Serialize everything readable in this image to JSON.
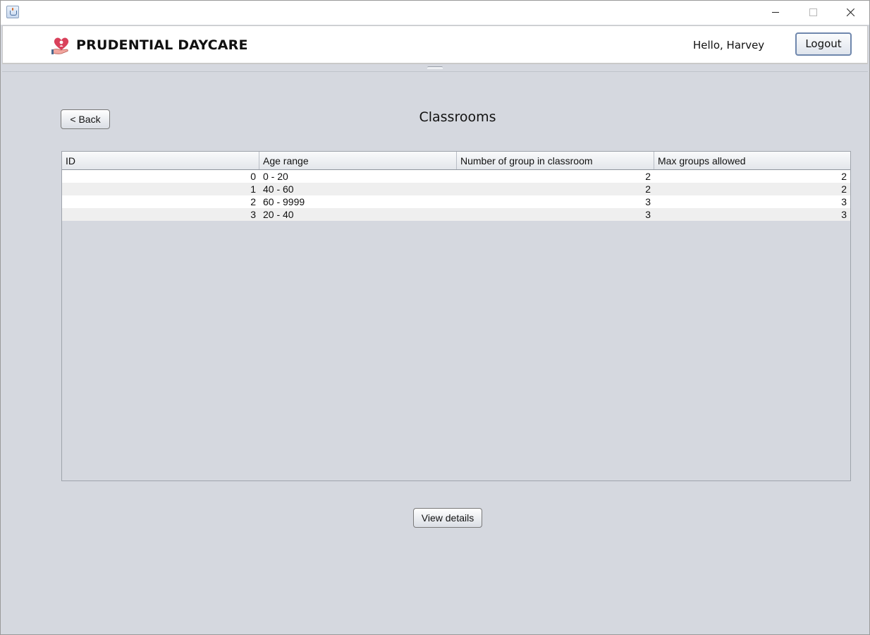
{
  "window": {
    "controls": [
      "minimize",
      "maximize",
      "close"
    ]
  },
  "header": {
    "brand": "PRUDENTIAL DAYCARE",
    "greeting": "Hello, Harvey",
    "logout_label": "Logout",
    "logo_icon": "heart-hand-logo-icon",
    "logo_color": "#d9415b"
  },
  "page": {
    "back_label": "< Back",
    "title": "Classrooms"
  },
  "table": {
    "columns": [
      "ID",
      "Age range",
      "Number of group in classroom",
      "Max groups allowed"
    ],
    "rows": [
      {
        "id": "0",
        "age_range": "0 - 20",
        "groups": "2",
        "max_groups": "2"
      },
      {
        "id": "1",
        "age_range": "40 - 60",
        "groups": "2",
        "max_groups": "2"
      },
      {
        "id": "2",
        "age_range": "60 - 9999",
        "groups": "3",
        "max_groups": "3"
      },
      {
        "id": "3",
        "age_range": "20 - 40",
        "groups": "3",
        "max_groups": "3"
      }
    ]
  },
  "actions": {
    "view_details_label": "View details"
  }
}
